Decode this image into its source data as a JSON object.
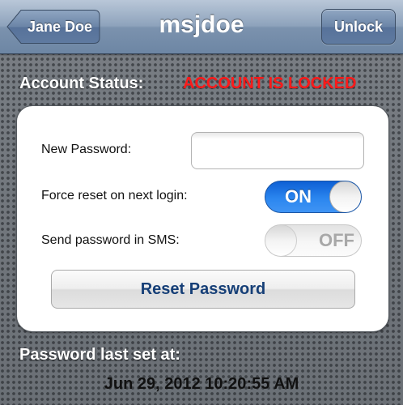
{
  "nav": {
    "title": "msjdoe",
    "back_label": "Jane Doe",
    "unlock_label": "Unlock"
  },
  "status": {
    "label": "Account Status:",
    "value": "ACCOUNT IS LOCKED",
    "value_color": "#ff1a1a"
  },
  "form": {
    "new_password_label": "New Password:",
    "new_password_value": "",
    "new_password_placeholder": "",
    "force_reset_label": "Force reset on next login:",
    "force_reset_state": "ON",
    "sms_label": "Send password in SMS:",
    "sms_state": "OFF",
    "reset_button_label": "Reset Password"
  },
  "last_set": {
    "label": "Password last set at:",
    "value": "Jun 29, 2012 10:20:55 AM"
  },
  "colors": {
    "nav_bar": "#7b92ae",
    "toggle_on": "#2b86ef",
    "reset_button_text": "#163f77"
  },
  "icons": {
    "back": "back-arrow-icon"
  }
}
